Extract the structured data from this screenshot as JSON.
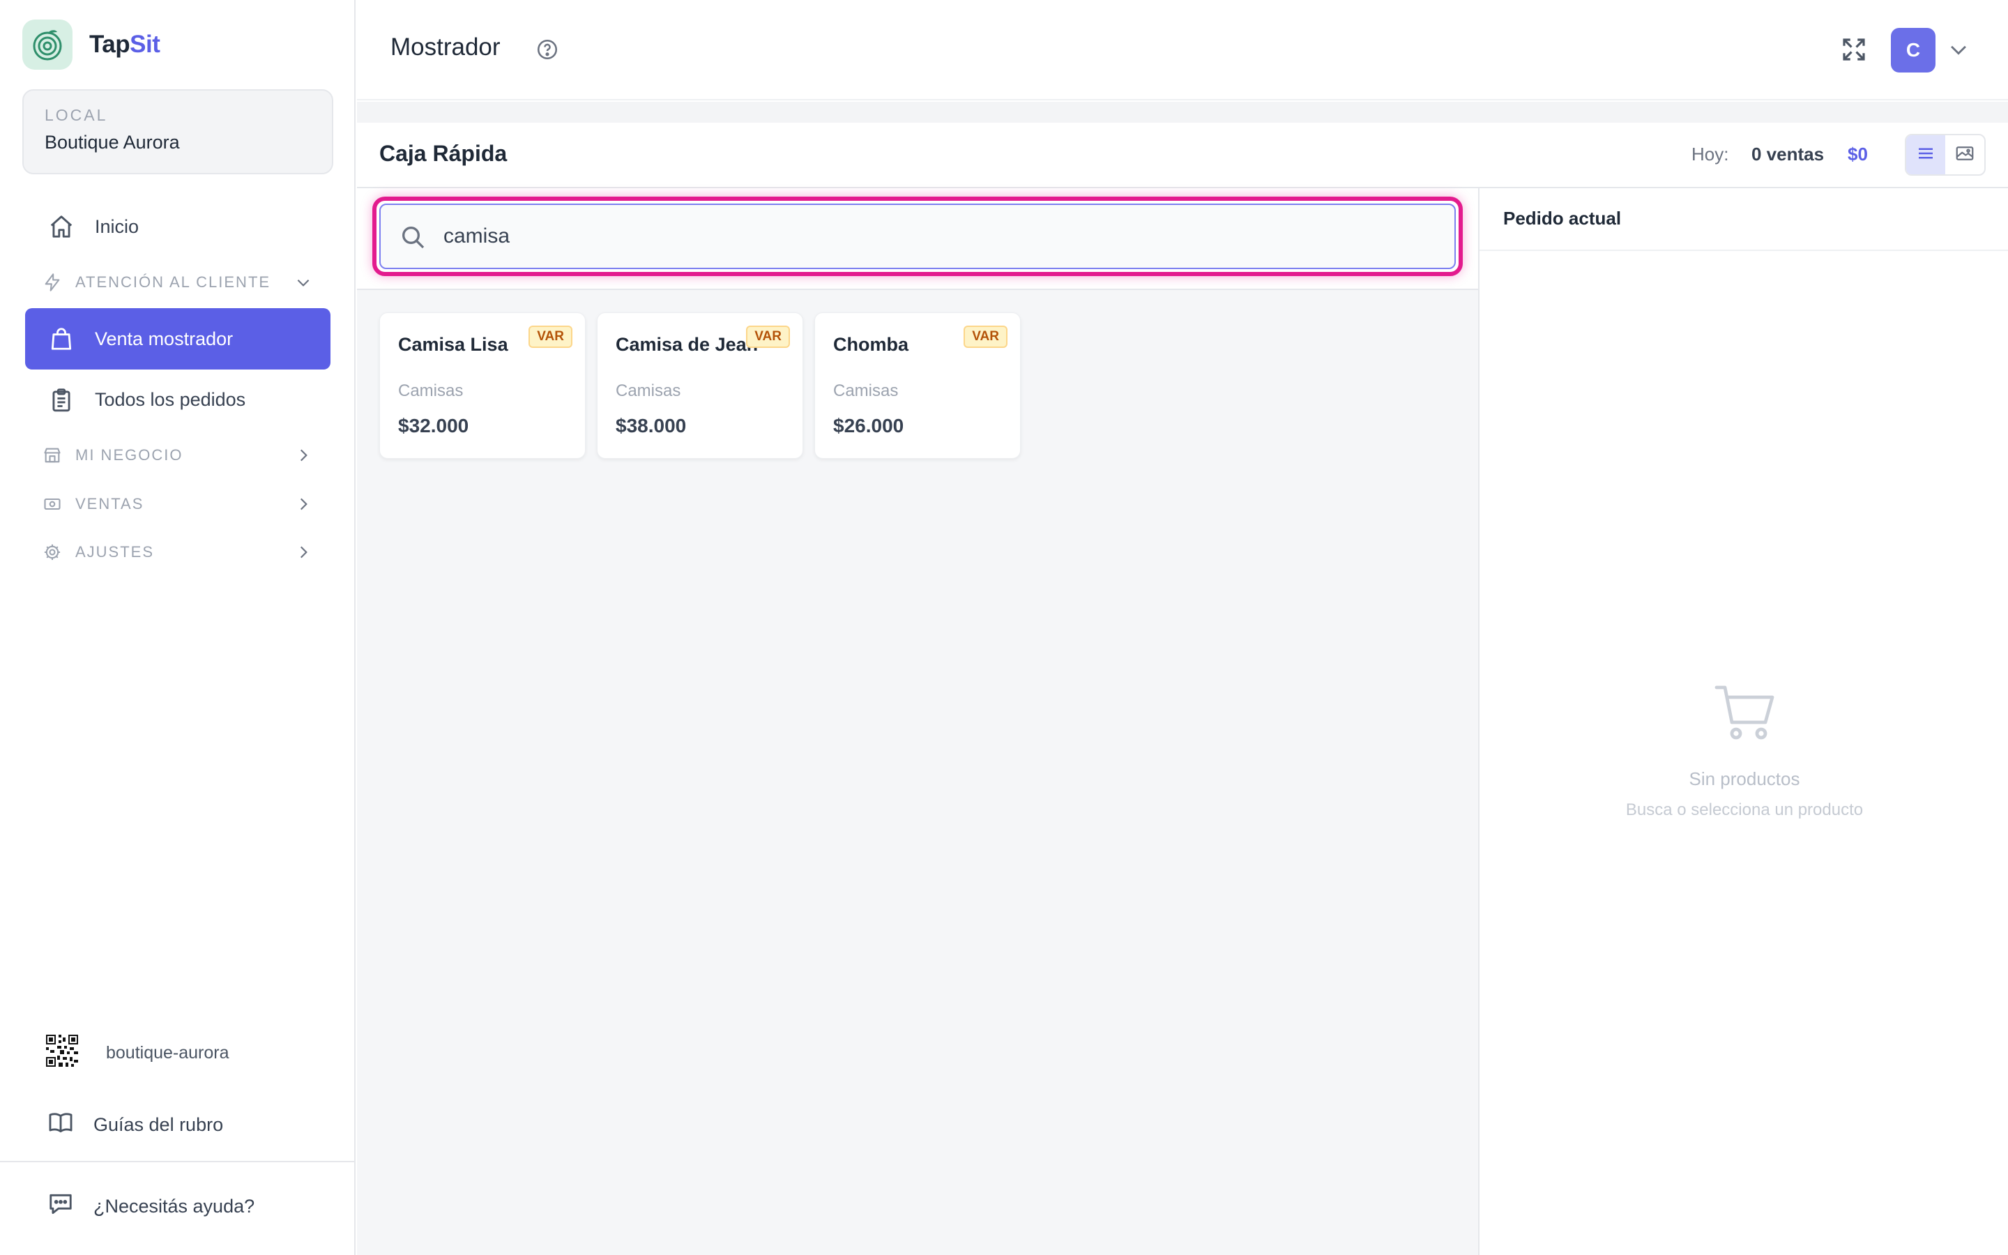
{
  "brand": {
    "name_prefix": "Tap",
    "name_suffix": "Sit"
  },
  "local": {
    "label": "LOCAL",
    "name": "Boutique Aurora"
  },
  "sidebar": {
    "items": [
      {
        "label": "Inicio",
        "icon": "home-icon"
      },
      {
        "label": "ATENCIÓN AL CLIENTE",
        "icon": "bolt-icon",
        "expanded": true
      },
      {
        "label": "Venta mostrador",
        "icon": "shopping-bag-icon",
        "active": true
      },
      {
        "label": "Todos los pedidos",
        "icon": "clipboard-icon"
      },
      {
        "label": "MI NEGOCIO",
        "icon": "store-icon"
      },
      {
        "label": "VENTAS",
        "icon": "cash-icon"
      },
      {
        "label": "AJUSTES",
        "icon": "gear-icon"
      }
    ],
    "bottom": {
      "slug": "boutique-aurora",
      "guides": "Guías del rubro",
      "help": "¿Necesitás ayuda?"
    }
  },
  "header": {
    "title": "Mostrador",
    "avatar_initial": "C"
  },
  "pos": {
    "title": "Caja Rápida",
    "today_label": "Hoy:",
    "today_sales": "0 ventas",
    "today_total": "$0"
  },
  "search": {
    "value": "camisa",
    "placeholder": ""
  },
  "products": [
    {
      "name": "Camisa Lisa",
      "badge": "VAR",
      "category": "Camisas",
      "price": "$32.000"
    },
    {
      "name": "Camisa de Jean",
      "badge": "VAR",
      "category": "Camisas",
      "price": "$38.000"
    },
    {
      "name": "Chomba",
      "badge": "VAR",
      "category": "Camisas",
      "price": "$26.000"
    }
  ],
  "order": {
    "title": "Pedido actual",
    "empty_title": "Sin productos",
    "empty_subtitle": "Busca o selecciona un producto"
  },
  "colors": {
    "accent": "#5b5fe6",
    "highlight": "#e31b8e",
    "badge_bg": "#fef3c7",
    "badge_text": "#b45309"
  }
}
